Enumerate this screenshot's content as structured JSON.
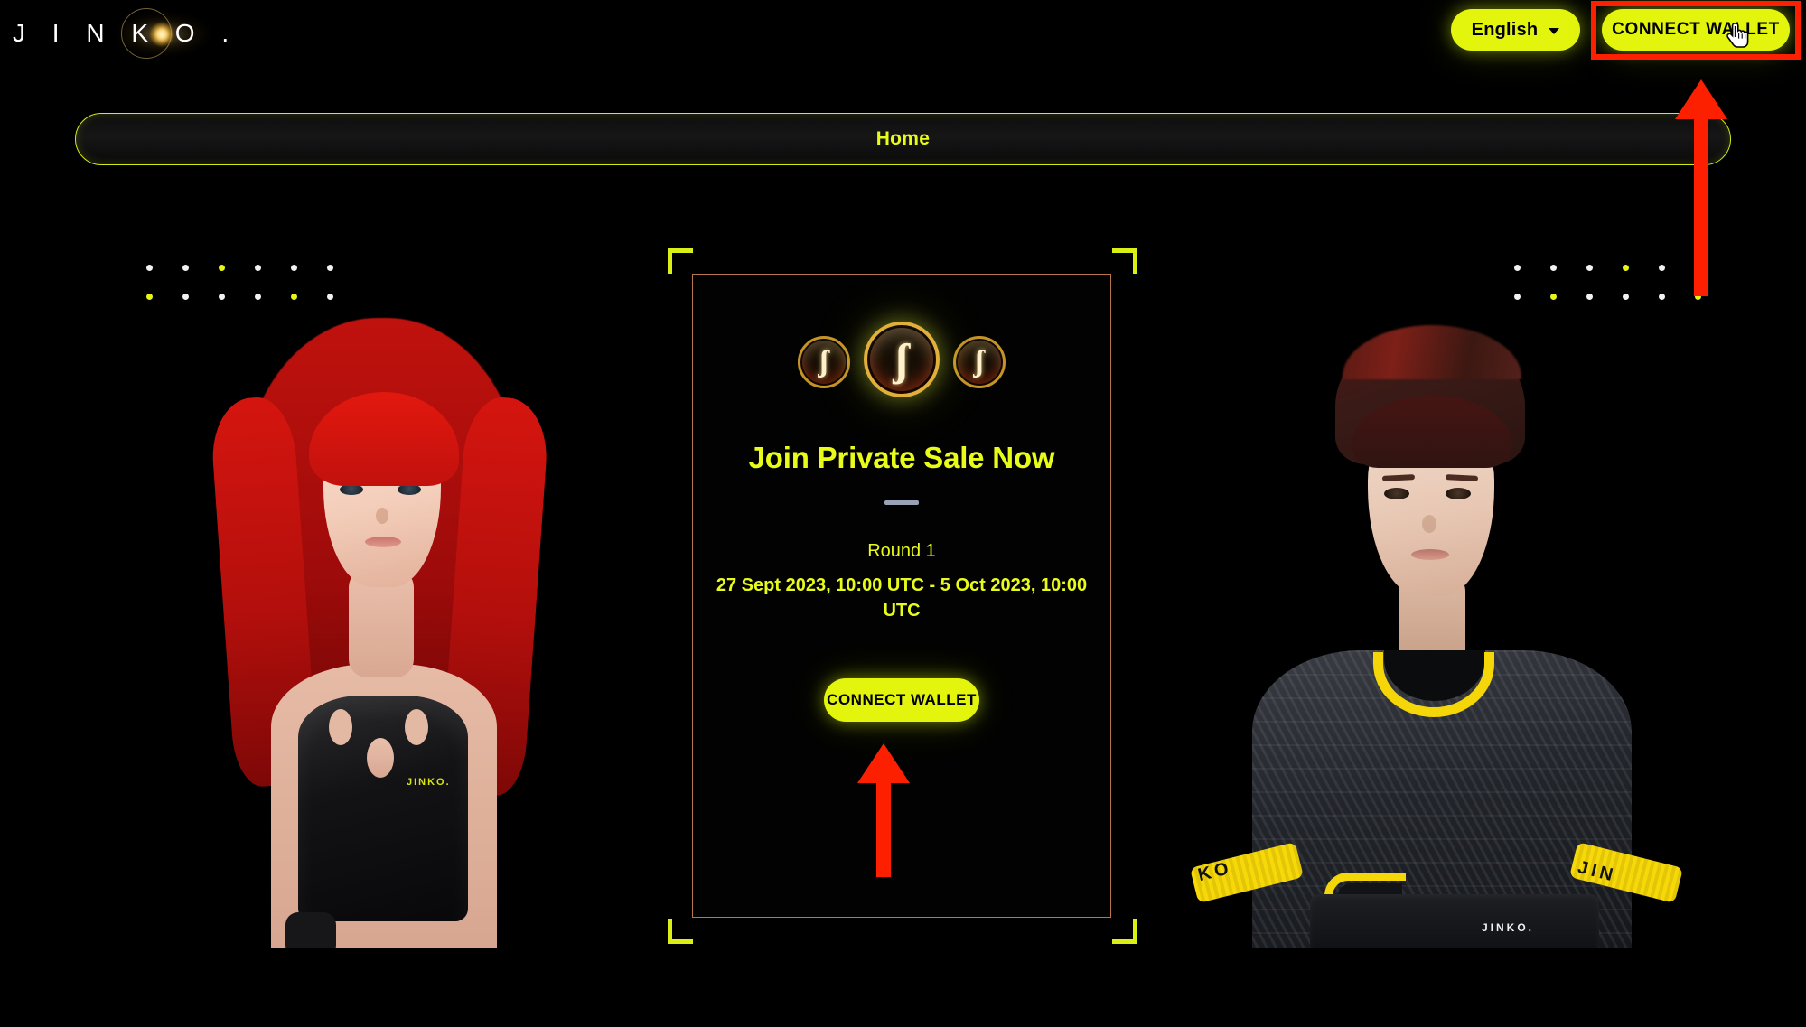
{
  "brand": {
    "logo_text": "J I N K O .",
    "logo_icon": "eclipse-flare-icon"
  },
  "header": {
    "language_label": "English",
    "language_chevron_icon": "chevron-down-icon",
    "connect_wallet_label": "CONNECT WALLET",
    "cursor_icon": "pointing-hand-cursor-icon",
    "highlight_color": "#fc2000"
  },
  "nav": {
    "items": [
      {
        "label": "Home",
        "active": true
      }
    ]
  },
  "decor": {
    "left_dots": [
      [
        "white",
        "white",
        "yellow",
        "white",
        "white",
        "white"
      ],
      [
        "yellow",
        "white",
        "white",
        "white",
        "yellow",
        "white"
      ]
    ],
    "right_dots": [
      [
        "white",
        "white",
        "white",
        "yellow",
        "white",
        "white"
      ],
      [
        "white",
        "yellow",
        "white",
        "white",
        "white",
        "yellow"
      ]
    ],
    "bracket_color": "#d9ef16",
    "panel_border_color": "#b9764e"
  },
  "panel": {
    "coin_icon": "jinko-token-coin-icon",
    "coin_glyph": "ʃ",
    "title": "Join Private Sale Now",
    "round_label": "Round 1",
    "date_range": "27 Sept 2023, 10:00 UTC  -  5 Oct 2023, 10:00 UTC",
    "connect_wallet_label": "CONNECT WALLET"
  },
  "characters": {
    "left": {
      "name": "female-avatar",
      "outfit_logo": "JINKO."
    },
    "right": {
      "name": "male-avatar",
      "belt_logo": "JINKO.",
      "armband_left_text": "KO",
      "armband_right_text": "JIN"
    }
  },
  "theme": {
    "background": "#000000",
    "accent_yellow": "#e3f50d",
    "accent_text_yellow": "#e9fb19",
    "gold": "#c59426",
    "annotation_red": "#fc2000"
  }
}
